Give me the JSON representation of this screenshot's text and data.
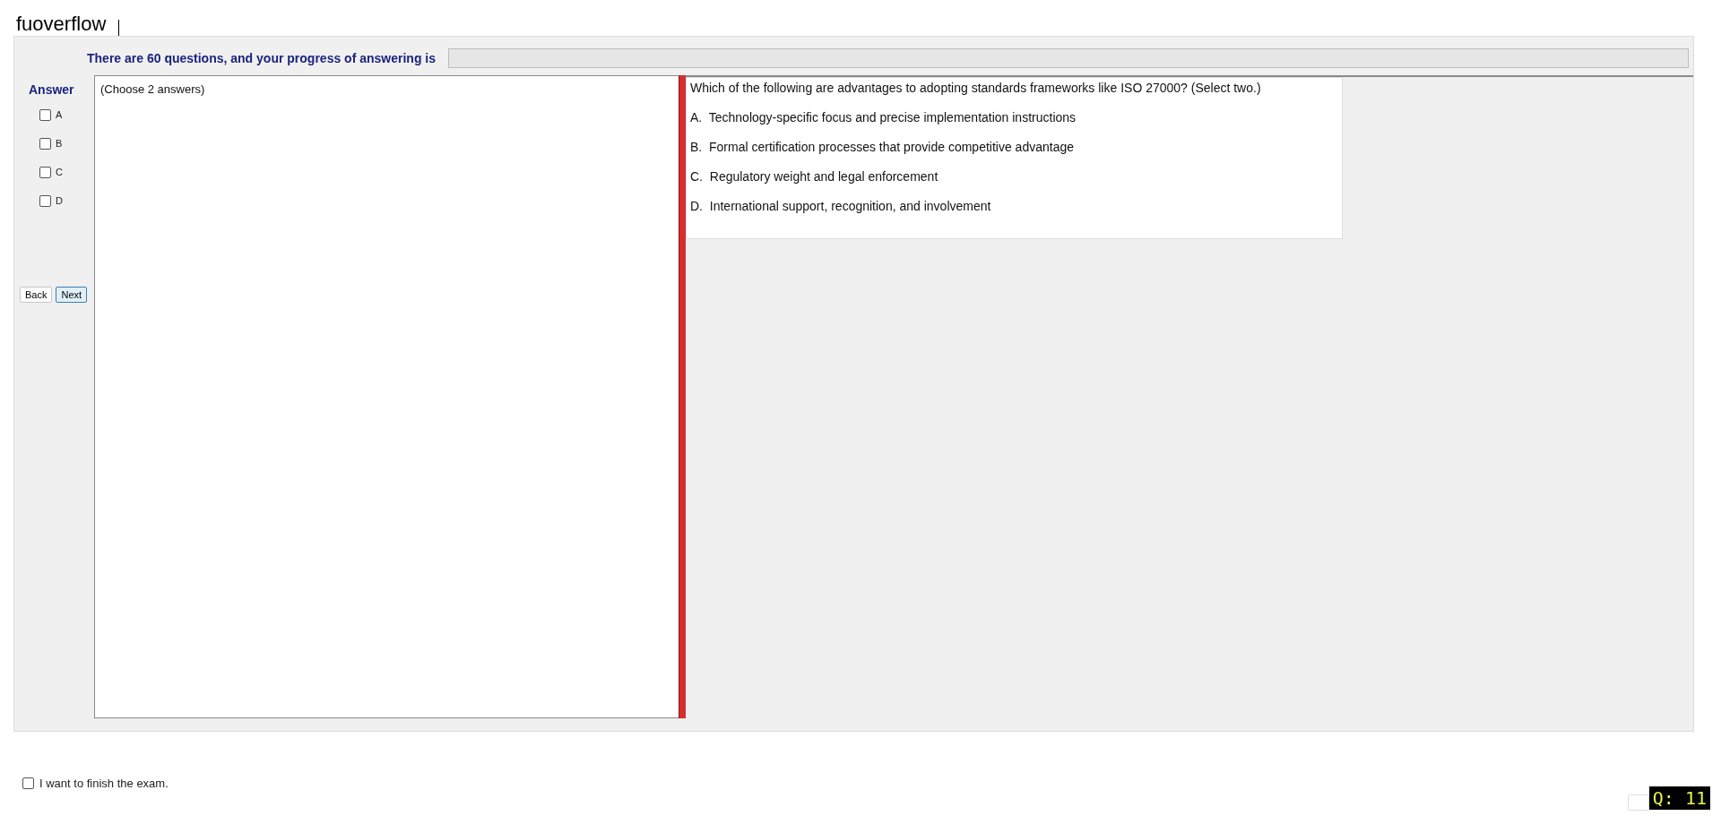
{
  "app_title": "fuoverflow",
  "progress": {
    "label": "There are 60 questions, and your progress of answering is",
    "level": 0
  },
  "answer_panel": {
    "title": "Answer",
    "options": [
      {
        "label": "A",
        "checked": false
      },
      {
        "label": "B",
        "checked": false
      },
      {
        "label": "C",
        "checked": false
      },
      {
        "label": "D",
        "checked": false
      }
    ],
    "buttons": [
      {
        "label": "Back",
        "selected": false
      },
      {
        "label": "Next",
        "selected": true
      }
    ]
  },
  "instruction": "(Choose 2 answers)",
  "question": {
    "text": "Which of the following are advantages to adopting standards frameworks like ISO 27000? (Select two.)",
    "choices": [
      "A.  Technology-specific focus and precise implementation instructions",
      "B.  Formal certification processes that provide competitive advantage",
      "C.  Regulatory weight and legal enforcement",
      "D.  International support, recognition, and involvement"
    ]
  },
  "finish": {
    "label": "I want to finish the exam.",
    "checked": false
  },
  "question_counter": "Q: 11"
}
